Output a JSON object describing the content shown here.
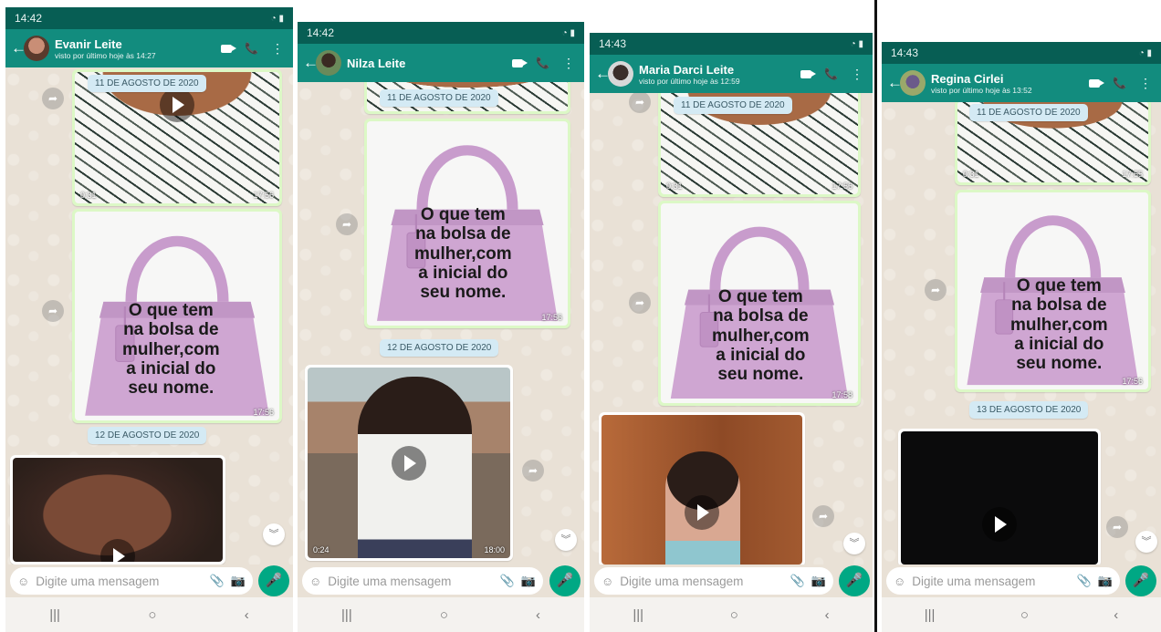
{
  "phones": [
    {
      "time": "14:42",
      "contact": "Evanir Leite",
      "last_seen": "visto por último hoje às 14:27",
      "dates": [
        "11 DE AGOSTO DE 2020",
        "12 DE AGOSTO DE 2020"
      ],
      "video1": {
        "duration": "0:31",
        "time": "17:56"
      },
      "bag": {
        "lines": [
          "O que tem",
          "na bolsa de",
          "mulher,com",
          "a inicial do",
          "seu nome."
        ],
        "time": "17:56"
      },
      "placeholder": "Digite uma mensagem"
    },
    {
      "time": "14:42",
      "contact": "Nilza Leite",
      "last_seen": "",
      "dates": [
        "11 DE AGOSTO DE 2020",
        "12 DE AGOSTO DE 2020"
      ],
      "bag": {
        "lines": [
          "O que tem",
          "na bolsa de",
          "mulher,com",
          "a inicial do",
          "seu nome."
        ],
        "time": "17:56"
      },
      "video2": {
        "duration": "0:24",
        "time": "18:00"
      },
      "placeholder": "Digite uma mensagem"
    },
    {
      "time": "14:43",
      "contact": "Maria Darci Leite",
      "last_seen": "visto por último hoje às 12:59",
      "dates": [
        "11 DE AGOSTO DE 2020"
      ],
      "video1": {
        "duration": "0:31",
        "time": "17:56"
      },
      "bag": {
        "lines": [
          "O que tem",
          "na bolsa de",
          "mulher,com",
          "a inicial do",
          "seu nome."
        ],
        "time": "17:58"
      },
      "placeholder": "Digite uma mensagem"
    },
    {
      "time": "14:43",
      "contact": "Regina Cirlei",
      "last_seen": "visto por último hoje às 13:52",
      "dates": [
        "11 DE AGOSTO DE 2020",
        "13 DE AGOSTO DE 2020"
      ],
      "video1": {
        "duration": "0:31",
        "time": "17:55"
      },
      "bag": {
        "lines": [
          "O que tem",
          "na bolsa de",
          "mulher,com",
          "a inicial do",
          "seu nome."
        ],
        "time": "17:56"
      },
      "placeholder": "Digite uma mensagem"
    }
  ],
  "colors": {
    "header": "#128c7e",
    "status": "#075e54",
    "bubble_out": "#dcf8c6",
    "mic": "#00a884",
    "bag": "#cfa6d2"
  },
  "icons": {
    "back": "←",
    "call": "📞",
    "menu": "⋮",
    "emoji": "☺",
    "attach": "📎",
    "camera": "📷",
    "mic": "🎤",
    "forward": "➦",
    "scroll_down": "︾",
    "nav_recent": "|||",
    "nav_home": "○",
    "nav_back": "‹"
  }
}
